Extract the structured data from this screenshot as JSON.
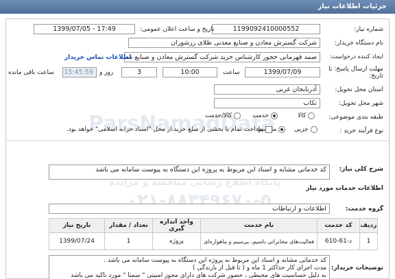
{
  "header": {
    "title": "جزئیات اطلاعات نیاز"
  },
  "need_number": {
    "label": "شماره نیاز:",
    "value": "1199092410000552"
  },
  "announce_date": {
    "label": "تاریخ و ساعت اعلان عمومی:",
    "value": "1399/07/05 - 17:49"
  },
  "buyer": {
    "label": "نام دستگاه خریدار:",
    "value": "شرکت گسترش معادن و صنایع معدنی طلای زرشوران"
  },
  "creator": {
    "label": "ایجاد کننده درخواست:",
    "value": "صمد قهرمانی خجور کارشناس خرید شرکت گسترش معادن و صنایع معدنی طلای زرشوران",
    "contact_link": "اطلاعات تماس خریدار"
  },
  "deadline": {
    "label": "مهلت ارسال پاسخ: تا تاریخ:",
    "date": "1399/07/09",
    "time_label": "ساعت",
    "time": "10:00",
    "days": "3",
    "days_label": "روز و",
    "remaining": "15:45:59",
    "remaining_label": "ساعت باقی مانده"
  },
  "province": {
    "label": "استان محل تحویل:",
    "value": "آذربایجان غربی"
  },
  "city": {
    "label": "شهر محل تحویل:",
    "value": "تکاب"
  },
  "category": {
    "label": "طبقه بندی موضوعی:",
    "options": [
      "کالا",
      "خدمت",
      "کالا/خدمت"
    ],
    "selected": "خدمت"
  },
  "process": {
    "label": "نوع فرآیند خرید :",
    "options": [
      "جزیی",
      "متوسط"
    ],
    "selected": "متوسط",
    "payment_text": "پرداخت تمام یا بخشی از مبلغ خرید،از محل \"اسناد خزانه اسلامی\" خواهد بود."
  },
  "description": {
    "label": "شرح کلی نیاز:",
    "value": "کد خدماتی مشابه و اسناد این مربوط به پروژه این دستگاه به پیوست سامانه می باشد"
  },
  "services_title": "اطلاعات خدمات مورد نیاز",
  "service_group": {
    "label": "گروه خدمت:",
    "value": "اطلاعات و ارتباطات"
  },
  "table": {
    "headers": [
      "ردیف",
      "کد خدمت",
      "نام خدمت",
      "واحد اندازه گیری",
      "تعداد / مقدار",
      "تاریخ نیاز"
    ],
    "rows": [
      [
        "1",
        "د-61-610",
        "فعالیت‌های مخابراتی باسیم، بی‌سیم و ماهواره‌ای",
        "پروژه",
        "1",
        "1399/07/24"
      ]
    ]
  },
  "buyer_notes": {
    "label": "توضیحات خریدار:",
    "lines": [
      "کد خدماتی مشابه و اسناد این مربوط به پروژه این دستگاه به پیوست سامانه می باشد .",
      "مدت اجرای کار حداکثر 1 ماه و ( تا قبل از بارندگی )",
      "به دلیل حساسیت های محیطی ، حضور شرکت های دارای مجوز امنیتی \" سمتا \" مورد تاکید می باشد"
    ]
  },
  "watermarks": [
    "ParsNamadData",
    "پایگاه اطلاع رسانی مناقصه و مزایده",
    "۰۲۱-۸۸۳۴۹۶۷۰-۵"
  ]
}
